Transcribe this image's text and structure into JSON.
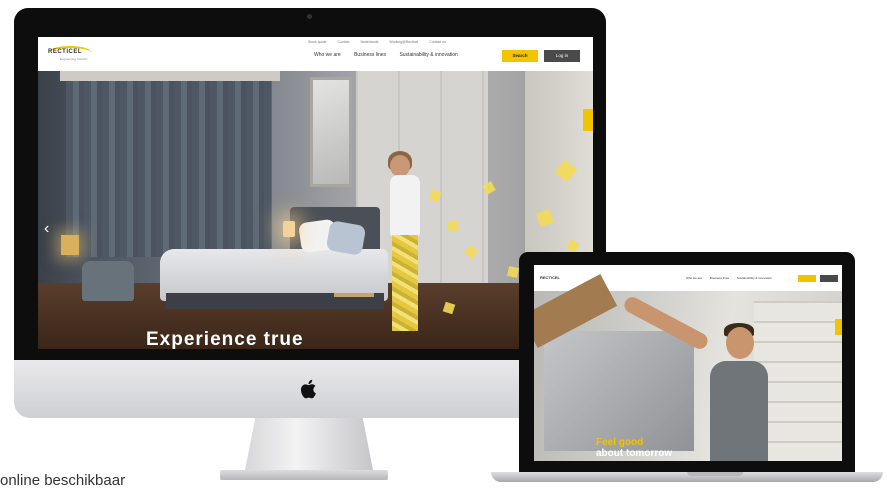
{
  "imac_site": {
    "logo_name": "RECTICEL",
    "logo_tagline": "Engineering Comfort",
    "utility_links": [
      "Stock quote",
      "Contact",
      "Nederlands",
      "Working@Recticel",
      "Contact us"
    ],
    "nav": [
      "Who we are",
      "Business lines",
      "Sustainability & innovation"
    ],
    "search_label": "Search",
    "login_label": "Log in",
    "hero_title": "Experience true"
  },
  "macbook_site": {
    "logo_name": "RECTICEL",
    "nav": [
      "Who we are",
      "Business lines",
      "Sustainability & innovation"
    ],
    "hero_title_line1": "Feel good",
    "hero_title_line2": "about tomorrow"
  },
  "caption": "online beschikbaar",
  "colors": {
    "accent_yellow": "#f2c300",
    "dark_button": "#4a4a4a",
    "device_black": "#0d0d0d"
  },
  "icons": {
    "apple_logo": "apple-logo-icon",
    "hero_prev": "chevron-left-icon"
  }
}
